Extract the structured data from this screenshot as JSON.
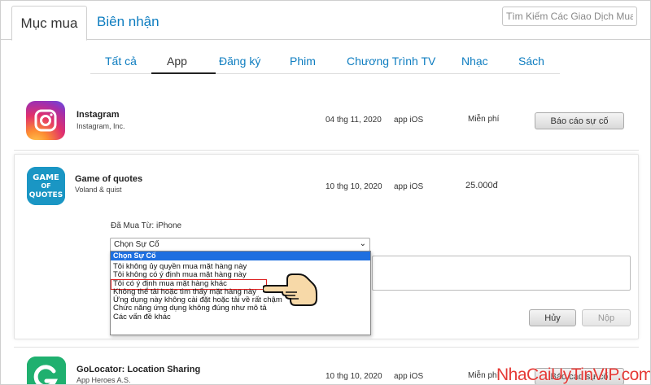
{
  "header": {
    "tabs": [
      {
        "label": "Mục mua",
        "active": true
      },
      {
        "label": "Biên nhận",
        "active": false
      }
    ],
    "search_placeholder": "Tìm Kiếm Các Giao Dịch Mua H"
  },
  "categories": [
    "Tất cả",
    "App",
    "Đăng ký",
    "Phim",
    "Chương Trình TV",
    "Nhạc",
    "Sách"
  ],
  "active_category": "App",
  "purchases": [
    {
      "name": "Instagram",
      "publisher": "Instagram, Inc.",
      "date": "04 thg 11, 2020",
      "type": "app iOS",
      "price": "Miễn phí",
      "action": "Báo cáo sự cố",
      "icon": "instagram-icon"
    },
    {
      "name": "Game of quotes",
      "publisher": "Voland & quist",
      "date": "10 thg 10, 2020",
      "type": "app iOS",
      "price": "25.000đ",
      "icon": "game-of-quotes-icon",
      "icon_text": [
        "GAME",
        "OF",
        "QUOTES"
      ]
    },
    {
      "name": "GoLocator: Location Sharing",
      "publisher": "App Heroes A.S.",
      "date": "10 thg 10, 2020",
      "type": "app iOS",
      "price": "Miễn phí",
      "action": "Báo cáo sự cố",
      "icon": "golocator-icon"
    }
  ],
  "report_panel": {
    "purchased_from": "Đã Mua Từ: iPhone",
    "select_value": "Chọn Sự Cố",
    "options_header": "Chọn Sự Cố",
    "options": [
      "Tôi không ủy quyền mua mặt hàng này",
      "Tôi không có ý định mua mặt hàng này",
      "Tôi có ý định mua mặt hàng khác",
      "Không thể tải hoặc tìm thấy mặt hàng này",
      "Ứng dụng này không cài đặt hoặc tải về rất chậm",
      "Chức năng ứng dụng không đúng như mô tả",
      "Các vấn đề khác"
    ],
    "highlighted_option_index": 2,
    "cancel_label": "Hủy",
    "submit_label": "Nộp"
  },
  "watermark": "NhaCaiUyTinVIP.com",
  "colors": {
    "link": "#0e7dc0",
    "dropdown_highlight": "#1e6fe0",
    "marker": "#dd2222",
    "watermark": "#e53935"
  }
}
